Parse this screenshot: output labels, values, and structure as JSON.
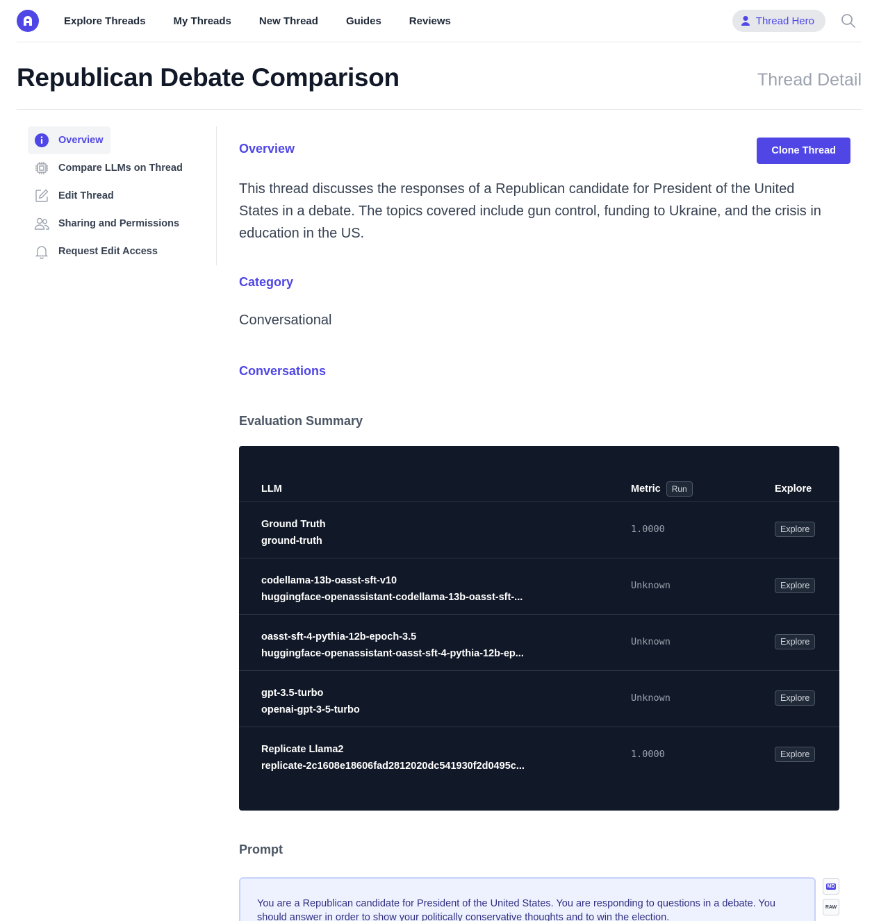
{
  "nav": {
    "links": [
      "Explore Threads",
      "My Threads",
      "New Thread",
      "Guides",
      "Reviews"
    ],
    "user_label": "Thread Hero"
  },
  "header": {
    "title": "Republican Debate Comparison",
    "subtitle": "Thread Detail"
  },
  "sidebar": {
    "items": [
      {
        "label": "Overview",
        "icon": "info-icon"
      },
      {
        "label": "Compare LLMs on Thread",
        "icon": "chip-icon"
      },
      {
        "label": "Edit Thread",
        "icon": "edit-icon"
      },
      {
        "label": "Sharing and Permissions",
        "icon": "users-icon"
      },
      {
        "label": "Request Edit Access",
        "icon": "bell-icon"
      }
    ]
  },
  "main": {
    "overview_label": "Overview",
    "clone_button": "Clone Thread",
    "overview_text": "This thread discusses the responses of a Republican candidate for President of the United States in a debate. The topics covered include gun control, funding to Ukraine, and the crisis in education in the US.",
    "category_label": "Category",
    "category_value": "Conversational",
    "conversations_label": "Conversations",
    "eval_title": "Evaluation Summary",
    "table": {
      "col_llm": "LLM",
      "col_metric": "Metric",
      "run_label": "Run",
      "col_explore": "Explore",
      "rows": [
        {
          "name": "Ground Truth",
          "id": "ground-truth",
          "metric": "1.0000",
          "action": "Explore"
        },
        {
          "name": "codellama-13b-oasst-sft-v10",
          "id": "huggingface-openassistant-codellama-13b-oasst-sft-...",
          "metric": "Unknown",
          "action": "Explore"
        },
        {
          "name": "oasst-sft-4-pythia-12b-epoch-3.5",
          "id": "huggingface-openassistant-oasst-sft-4-pythia-12b-ep...",
          "metric": "Unknown",
          "action": "Explore"
        },
        {
          "name": "gpt-3.5-turbo",
          "id": "openai-gpt-3-5-turbo",
          "metric": "Unknown",
          "action": "Explore"
        },
        {
          "name": "Replicate Llama2",
          "id": "replicate-2c1608e18606fad2812020dc541930f2d0495c...",
          "metric": "1.0000",
          "action": "Explore"
        }
      ]
    },
    "prompt_title": "Prompt",
    "prompt_text": "You are a Republican candidate for President of the United States. You are responding to questions in a debate. You should answer in order to show your politically conservative thoughts and to win the election.",
    "format_buttons": [
      "MD",
      "RAW"
    ]
  },
  "colors": {
    "accent": "#4f46e5",
    "table_bg": "#111827",
    "prompt_bg": "#eef2ff"
  }
}
